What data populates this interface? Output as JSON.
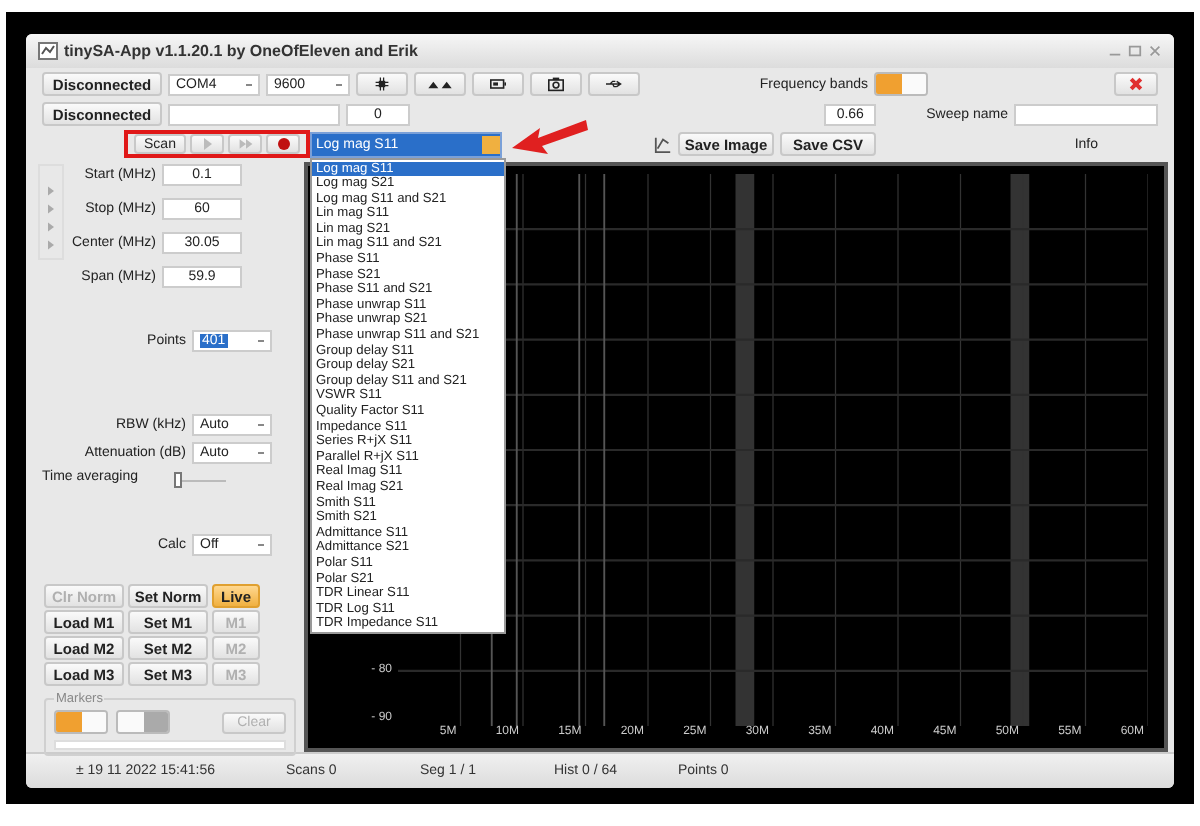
{
  "window": {
    "title": "tinySA-App v1.1.20.1 by OneOfEleven and Erik"
  },
  "toolbar": {
    "connection_button": "Disconnected",
    "port": "COM4",
    "baud": "9600",
    "frequency_bands_label": "Frequency bands",
    "frequency_bands_on": true
  },
  "second_row": {
    "status_button": "Disconnected",
    "counter": "0",
    "value": "0.66",
    "sweep_name_label": "Sweep name"
  },
  "scan": {
    "label": "Scan",
    "recording": true
  },
  "trace_select": {
    "value": "Log mag S11",
    "open": true,
    "options": [
      {
        "label": "Log mag S11",
        "selected": true
      },
      {
        "label": "Log mag S21",
        "selected": false
      },
      {
        "label": "Log mag S11 and S21",
        "selected": false
      },
      {
        "label": "Lin mag S11",
        "selected": false
      },
      {
        "label": "Lin mag S21",
        "selected": false
      },
      {
        "label": "Lin mag S11 and S21",
        "selected": false
      },
      {
        "label": "Phase S11",
        "selected": false
      },
      {
        "label": "Phase S21",
        "selected": false
      },
      {
        "label": "Phase S11 and S21",
        "selected": false
      },
      {
        "label": "Phase unwrap S11",
        "selected": false
      },
      {
        "label": "Phase unwrap S21",
        "selected": false
      },
      {
        "label": "Phase unwrap S11 and S21",
        "selected": false
      },
      {
        "label": "Group delay S11",
        "selected": false
      },
      {
        "label": "Group delay S21",
        "selected": false
      },
      {
        "label": "Group delay S11 and S21",
        "selected": false
      },
      {
        "label": "VSWR S11",
        "selected": false
      },
      {
        "label": "Quality Factor S11",
        "selected": false
      },
      {
        "label": "Impedance S11",
        "selected": false
      },
      {
        "label": "Series R+jX S11",
        "selected": false
      },
      {
        "label": "Parallel R+jX S11",
        "selected": false
      },
      {
        "label": "Real Imag S11",
        "selected": false
      },
      {
        "label": "Real Imag S21",
        "selected": false
      },
      {
        "label": "Smith S11",
        "selected": false
      },
      {
        "label": "Smith S21",
        "selected": false
      },
      {
        "label": "Admittance S11",
        "selected": false
      },
      {
        "label": "Admittance S21",
        "selected": false
      },
      {
        "label": "Polar S11",
        "selected": false
      },
      {
        "label": "Polar S21",
        "selected": false
      },
      {
        "label": "TDR Linear S11",
        "selected": false
      },
      {
        "label": "TDR Log S11",
        "selected": false
      },
      {
        "label": "TDR Impedance S11",
        "selected": false
      }
    ]
  },
  "actions": [
    "Save Image",
    "Save CSV"
  ],
  "info_label": "Info",
  "frequency": [
    {
      "label": "Start (MHz)",
      "value": "0.1"
    },
    {
      "label": "Stop (MHz)",
      "value": "60"
    },
    {
      "label": "Center (MHz)",
      "value": "30.05"
    },
    {
      "label": "Span (MHz)",
      "value": "59.9"
    }
  ],
  "points": {
    "label": "Points",
    "value": "401"
  },
  "rbw": {
    "label": "RBW (kHz)",
    "value": "Auto"
  },
  "attenuation": {
    "label": "Attenuation (dB)",
    "value": "Auto"
  },
  "time_averaging": {
    "label": "Time averaging",
    "level": 0
  },
  "calc": {
    "label": "Calc",
    "value": "Off"
  },
  "memory_buttons": [
    {
      "label": "Clr Norm",
      "disabled": true,
      "active": false
    },
    {
      "label": "Set Norm",
      "disabled": false,
      "active": false
    },
    {
      "label": "Live",
      "disabled": false,
      "active": true
    },
    {
      "label": "Load M1",
      "disabled": false,
      "active": false
    },
    {
      "label": "Set M1",
      "disabled": false,
      "active": false
    },
    {
      "label": "M1",
      "disabled": true,
      "active": false
    },
    {
      "label": "Load M2",
      "disabled": false,
      "active": false
    },
    {
      "label": "Set M2",
      "disabled": false,
      "active": false
    },
    {
      "label": "M2",
      "disabled": true,
      "active": false
    },
    {
      "label": "Load M3",
      "disabled": false,
      "active": false
    },
    {
      "label": "Set M3",
      "disabled": false,
      "active": false
    },
    {
      "label": "M3",
      "disabled": true,
      "active": false
    }
  ],
  "markers": {
    "label": "Markers",
    "toggles": [
      {
        "on": true
      },
      {
        "on": false
      }
    ],
    "clear_button": {
      "label": "Clear",
      "disabled": true
    },
    "progress": {
      "level": 0
    }
  },
  "chart": {
    "y_labels": [
      "- 80",
      "- 90"
    ],
    "x_labels": [
      "5M",
      "10M",
      "15M",
      "20M",
      "25M",
      "30M",
      "35M",
      "40M",
      "45M",
      "50M",
      "55M",
      "60M"
    ]
  },
  "status_bar": [
    "± 19 11 2022 15:41:56",
    "Scans 0",
    "Seg 1 / 1",
    "Hist 0 / 64",
    "Points 0"
  ]
}
